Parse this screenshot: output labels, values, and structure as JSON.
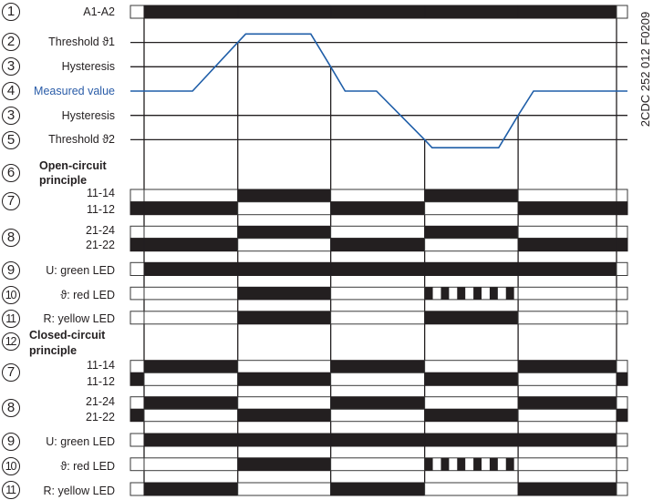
{
  "figure_code": "2CDC 252 012 F0209",
  "colors": {
    "bar_on": "#231f20",
    "bar_off": "#ffffff",
    "bar_outline": "#3a3a3a",
    "grid_line": "#231f20",
    "measured_line": "#1f5ea8",
    "measured_label": "#2a5ca8"
  },
  "supply": {
    "num": "1",
    "label": "A1-A2",
    "states": [
      "off",
      "on",
      "on",
      "on",
      "on",
      "on",
      "off"
    ]
  },
  "levels": {
    "threshold1": {
      "num": "2",
      "label": "Threshold ϑ1",
      "value": 2
    },
    "hysteresis_upper": {
      "num": "3",
      "label": "Hysteresis",
      "value": 1
    },
    "measured": {
      "num": "4",
      "label": "Measured value",
      "value": 0
    },
    "hysteresis_lower": {
      "num": "3",
      "label": "Hysteresis",
      "value": -1
    },
    "threshold2": {
      "num": "5",
      "label": "Threshold ϑ2",
      "value": -2
    }
  },
  "time_axis_unit": "percent of time axis",
  "phase_boundaries": [
    {
      "t": 2.75,
      "trigger": "supply-on"
    },
    {
      "t": 21.6,
      "trigger_level": 2
    },
    {
      "t": 40.3,
      "trigger_level": 1
    },
    {
      "t": 59.2,
      "trigger_level": -2
    },
    {
      "t": 78.0,
      "trigger_level": -1
    },
    {
      "t": 97.8,
      "trigger": "supply-off"
    }
  ],
  "measured_curve": [
    [
      0,
      0
    ],
    [
      12.5,
      0
    ],
    [
      21.6,
      2
    ],
    [
      23.2,
      2.35
    ],
    [
      36.3,
      2.35
    ],
    [
      40.3,
      1
    ],
    [
      43.2,
      0
    ],
    [
      49.5,
      0
    ],
    [
      59.2,
      -2
    ],
    [
      60.7,
      -2.33
    ],
    [
      74.1,
      -2.33
    ],
    [
      78.0,
      -1
    ],
    [
      81.1,
      0
    ],
    [
      100,
      0
    ]
  ],
  "flash_pulses": 6,
  "open_circuit": {
    "num": "6",
    "title_line1": "Open-circuit",
    "title_line2": "principle",
    "contact1": {
      "num": "7",
      "rows": [
        {
          "label": "11-14",
          "states": [
            "off",
            "off",
            "on",
            "off",
            "on",
            "off",
            "off"
          ]
        },
        {
          "label": "11-12",
          "states": [
            "on",
            "on",
            "off",
            "on",
            "off",
            "on",
            "on"
          ]
        }
      ]
    },
    "contact2": {
      "num": "8",
      "rows": [
        {
          "label": "21-24",
          "states": [
            "off",
            "off",
            "on",
            "off",
            "on",
            "off",
            "off"
          ]
        },
        {
          "label": "21-22",
          "states": [
            "on",
            "on",
            "off",
            "on",
            "off",
            "on",
            "on"
          ]
        }
      ]
    },
    "green_led": {
      "num": "9",
      "label": "U: green LED",
      "states": [
        "off",
        "on",
        "on",
        "on",
        "on",
        "on",
        "off"
      ]
    },
    "red_led": {
      "num": "10",
      "label": "ϑ: red LED",
      "states": [
        "off",
        "off",
        "on",
        "off",
        "flash",
        "off",
        "off"
      ]
    },
    "yellow_led": {
      "num": "11",
      "label": "R: yellow LED",
      "states": [
        "off",
        "off",
        "on",
        "off",
        "on",
        "off",
        "off"
      ]
    }
  },
  "closed_circuit": {
    "num": "12",
    "title_line1": "Closed-circuit",
    "title_line2": "principle",
    "contact1": {
      "num": "7",
      "rows": [
        {
          "label": "11-14",
          "states": [
            "off",
            "on",
            "off",
            "on",
            "off",
            "on",
            "off"
          ]
        },
        {
          "label": "11-12",
          "states": [
            "on",
            "off",
            "on",
            "off",
            "on",
            "off",
            "on"
          ]
        }
      ]
    },
    "contact2": {
      "num": "8",
      "rows": [
        {
          "label": "21-24",
          "states": [
            "off",
            "on",
            "off",
            "on",
            "off",
            "on",
            "off"
          ]
        },
        {
          "label": "21-22",
          "states": [
            "on",
            "off",
            "on",
            "off",
            "on",
            "off",
            "on"
          ]
        }
      ]
    },
    "green_led": {
      "num": "9",
      "label": "U: green LED",
      "states": [
        "off",
        "on",
        "on",
        "on",
        "on",
        "on",
        "off"
      ]
    },
    "red_led": {
      "num": "10",
      "label": "ϑ: red LED",
      "states": [
        "off",
        "off",
        "on",
        "off",
        "flash",
        "off",
        "off"
      ]
    },
    "yellow_led": {
      "num": "11",
      "label": "R: yellow LED",
      "states": [
        "off",
        "on",
        "off",
        "on",
        "off",
        "on",
        "off"
      ]
    }
  }
}
